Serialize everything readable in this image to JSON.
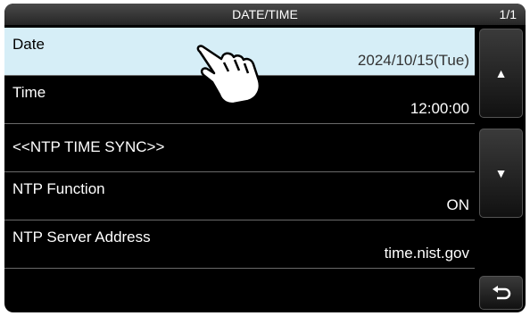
{
  "titlebar": {
    "title": "DATE/TIME",
    "page_indicator": "1/1"
  },
  "rows": [
    {
      "label": "Date",
      "value": "2024/10/15(Tue)"
    },
    {
      "label": "Time",
      "value": "12:00:00"
    },
    {
      "label": "<<NTP TIME SYNC>>",
      "value": ""
    },
    {
      "label": "NTP Function",
      "value": "ON"
    },
    {
      "label": "NTP Server Address",
      "value": "time.nist.gov"
    }
  ],
  "buttons": {
    "up": "▲",
    "down": "▼",
    "back": "return-icon"
  },
  "colors": {
    "selected_row": "#d6eef7",
    "background": "#000000"
  }
}
